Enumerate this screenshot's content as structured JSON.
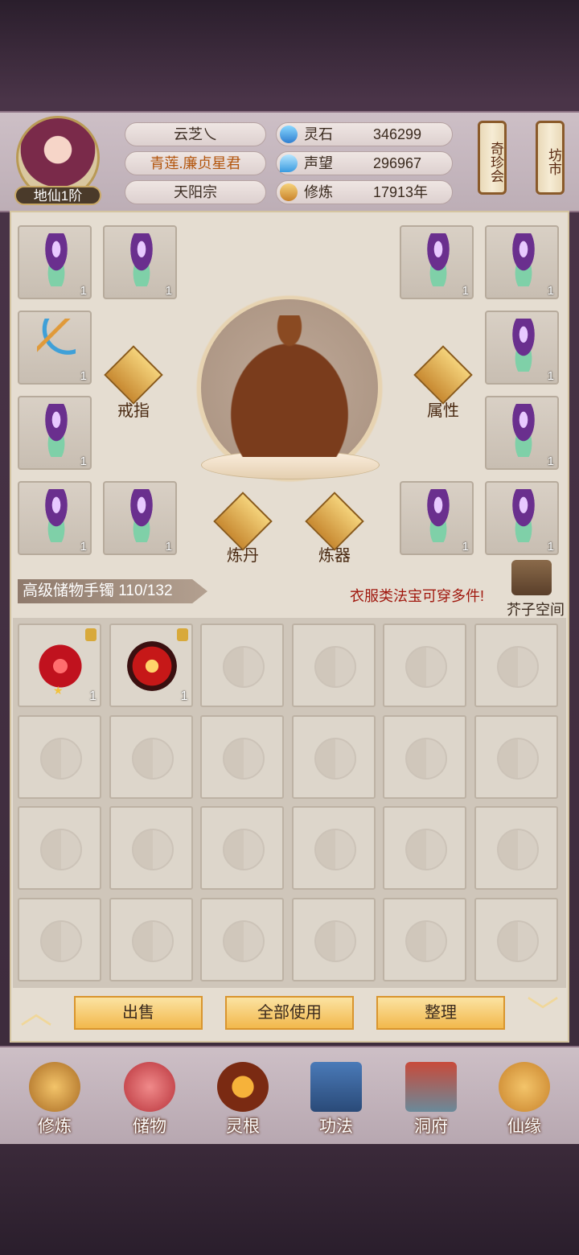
{
  "player": {
    "rank": "地仙1阶",
    "name": "云芝乀",
    "title": "青莲.廉贞星君",
    "sect": "天阳宗"
  },
  "stats": [
    {
      "icon": "spirit-stone-icon",
      "label": "灵石",
      "value": "346299"
    },
    {
      "icon": "reputation-icon",
      "label": "声望",
      "value": "296967"
    },
    {
      "icon": "cultivation-icon",
      "label": "修炼",
      "value": "17913年"
    }
  ],
  "side_buttons": [
    {
      "label": "奇珍会"
    },
    {
      "label": "坊市"
    }
  ],
  "equipment": {
    "slot_count": "1",
    "ring_label": "戒指",
    "attributes_label": "属性",
    "alchemy_label": "炼丹",
    "forge_label": "炼器"
  },
  "inventory": {
    "bag_name": "高级储物手镯 110/132",
    "tip": "衣服类法宝可穿多件!",
    "space_label": "芥子空间",
    "items": [
      {
        "kind": "red-flower-item",
        "count": "1",
        "locked": true
      },
      {
        "kind": "red-orb-item",
        "count": "1",
        "locked": true
      }
    ]
  },
  "actions": {
    "sell": "出售",
    "use_all": "全部使用",
    "sort": "整理"
  },
  "nav": [
    {
      "label": "修炼",
      "icon": "monk-icon"
    },
    {
      "label": "储物",
      "icon": "bag-icon"
    },
    {
      "label": "灵根",
      "icon": "spirit-root-icon"
    },
    {
      "label": "功法",
      "icon": "book-icon"
    },
    {
      "label": "洞府",
      "icon": "cave-house-icon"
    },
    {
      "label": "仙缘",
      "icon": "gourd-icon"
    }
  ],
  "colors": {
    "accent": "#f2b84c",
    "tip": "#a0180e",
    "panel": "#e5ddd1"
  }
}
